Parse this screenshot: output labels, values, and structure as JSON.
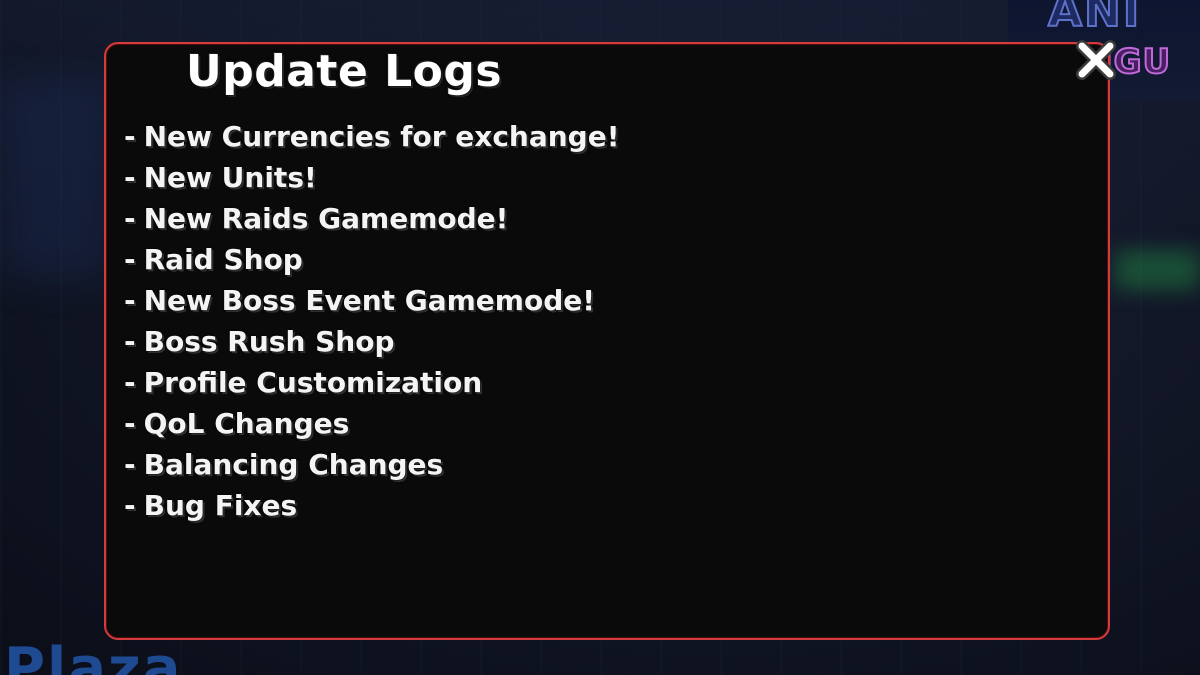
{
  "background": {
    "logo_line1": "ANI",
    "logo_line2": "IGU",
    "location_label": "Plaza"
  },
  "modal": {
    "title": "Update Logs",
    "close_icon": "close-icon",
    "border_color": "#d43b3b",
    "items": [
      "New Currencies for exchange!",
      "New Units!",
      "New Raids Gamemode!",
      "Raid Shop",
      "New Boss Event Gamemode!",
      "Boss Rush Shop",
      "Profile Customization",
      "QoL Changes",
      "Balancing Changes",
      "Bug Fixes"
    ],
    "bullet": "-"
  }
}
